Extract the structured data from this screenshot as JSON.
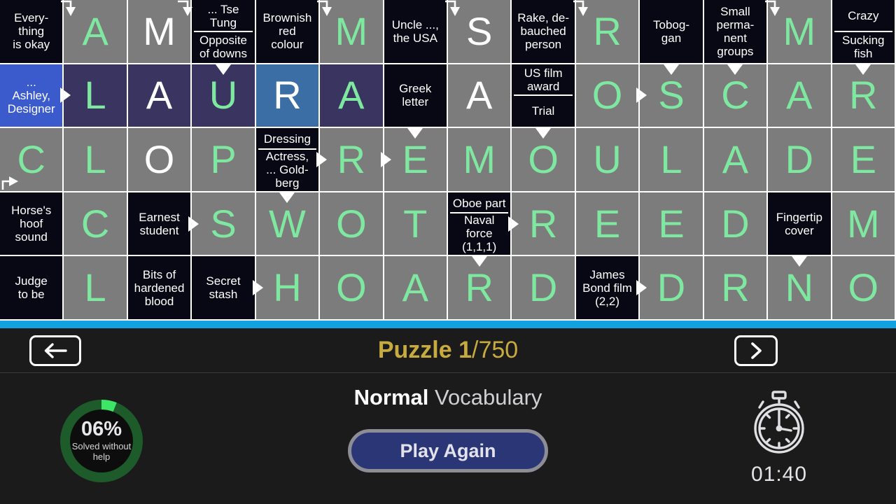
{
  "grid": {
    "cols": 14,
    "rows": 5,
    "colors": {
      "letter_cell": "#7c7c7c",
      "clue_cell": "#080814",
      "selected_cell": "#3a6ea5",
      "active_row": "#3a3460",
      "active_clue": "#3b5bcc",
      "letter_green": "#7fe8a0",
      "letter_white": "#ffffff",
      "grid_line": "#ffffff"
    },
    "cells": [
      [
        {
          "t": "clue",
          "lines": [
            "Every-",
            "thing",
            "is okay"
          ]
        },
        {
          "t": "letter",
          "ch": "A",
          "c": "green",
          "arrow": "down-from-left"
        },
        {
          "t": "letter",
          "ch": "M",
          "c": "white",
          "arrow": "down-from-left-right"
        },
        {
          "t": "clue2",
          "top": [
            "... Tse",
            "Tung"
          ],
          "bottom": [
            "Opposite",
            "of downs"
          ]
        },
        {
          "t": "clue",
          "lines": [
            "Brownish",
            "red",
            "colour"
          ]
        },
        {
          "t": "letter",
          "ch": "M",
          "c": "green",
          "arrow": "down-from-left"
        },
        {
          "t": "clue",
          "lines": [
            "Uncle ...,",
            "the USA"
          ]
        },
        {
          "t": "letter",
          "ch": "S",
          "c": "white",
          "arrow": "down-from-left"
        },
        {
          "t": "clue",
          "lines": [
            "Rake, de-",
            "bauched",
            "person"
          ]
        },
        {
          "t": "letter",
          "ch": "R",
          "c": "green",
          "arrow": "down-from-left"
        },
        {
          "t": "clue",
          "lines": [
            "Tobog-",
            "gan"
          ]
        },
        {
          "t": "clue",
          "lines": [
            "Small",
            "perma-",
            "nent",
            "groups"
          ]
        },
        {
          "t": "letter",
          "ch": "M",
          "c": "green",
          "arrow": "down-from-left"
        },
        {
          "t": "clue2",
          "top": [
            "Crazy"
          ],
          "bottom": [
            "Sucking",
            "fish"
          ]
        }
      ],
      [
        {
          "t": "clue",
          "lines": [
            "...",
            "Ashley,",
            "Designer"
          ],
          "active": true,
          "arrow": "right"
        },
        {
          "t": "letter",
          "ch": "L",
          "c": "green",
          "row_active": true
        },
        {
          "t": "letter",
          "ch": "A",
          "c": "white",
          "row_active": true
        },
        {
          "t": "letter",
          "ch": "U",
          "c": "green",
          "row_active": true,
          "arrow": "down"
        },
        {
          "t": "letter",
          "ch": "R",
          "c": "white",
          "selected": true
        },
        {
          "t": "letter",
          "ch": "A",
          "c": "green",
          "row_active": true
        },
        {
          "t": "clue",
          "lines": [
            "Greek",
            "letter"
          ]
        },
        {
          "t": "letter",
          "ch": "A",
          "c": "white"
        },
        {
          "t": "clue2",
          "top": [
            "US film",
            "award"
          ],
          "bottom": [
            "Trial"
          ]
        },
        {
          "t": "letter",
          "ch": "O",
          "c": "green",
          "arrow": "right"
        },
        {
          "t": "letter",
          "ch": "S",
          "c": "green",
          "arrow": "down"
        },
        {
          "t": "letter",
          "ch": "C",
          "c": "green",
          "arrow": "down"
        },
        {
          "t": "letter",
          "ch": "A",
          "c": "green"
        },
        {
          "t": "letter",
          "ch": "R",
          "c": "green",
          "arrow": "down"
        }
      ],
      [
        {
          "t": "letter",
          "ch": "C",
          "c": "green",
          "arrow": "right-from-bottom"
        },
        {
          "t": "letter",
          "ch": "L",
          "c": "green"
        },
        {
          "t": "letter",
          "ch": "O",
          "c": "white"
        },
        {
          "t": "letter",
          "ch": "P",
          "c": "green"
        },
        {
          "t": "clue2",
          "top": [
            "Dressing"
          ],
          "bottom": [
            "Actress,",
            "... Gold-",
            "berg"
          ],
          "arrow": "right"
        },
        {
          "t": "letter",
          "ch": "R",
          "c": "green",
          "arrow": "right"
        },
        {
          "t": "letter",
          "ch": "E",
          "c": "green",
          "arrow": "down"
        },
        {
          "t": "letter",
          "ch": "M",
          "c": "green"
        },
        {
          "t": "letter",
          "ch": "O",
          "c": "green",
          "arrow": "down"
        },
        {
          "t": "letter",
          "ch": "U",
          "c": "green"
        },
        {
          "t": "letter",
          "ch": "L",
          "c": "green"
        },
        {
          "t": "letter",
          "ch": "A",
          "c": "green"
        },
        {
          "t": "letter",
          "ch": "D",
          "c": "green"
        },
        {
          "t": "letter",
          "ch": "E",
          "c": "green"
        }
      ],
      [
        {
          "t": "clue",
          "lines": [
            "Horse's",
            "hoof",
            "sound"
          ]
        },
        {
          "t": "letter",
          "ch": "C",
          "c": "green"
        },
        {
          "t": "clue",
          "lines": [
            "Earnest",
            "student"
          ],
          "arrow": "right"
        },
        {
          "t": "letter",
          "ch": "S",
          "c": "green"
        },
        {
          "t": "letter",
          "ch": "W",
          "c": "green",
          "arrow": "down"
        },
        {
          "t": "letter",
          "ch": "O",
          "c": "green"
        },
        {
          "t": "letter",
          "ch": "T",
          "c": "green"
        },
        {
          "t": "clue2",
          "top": [
            "Oboe part"
          ],
          "bottom": [
            "Naval",
            "force",
            "(1,1,1)"
          ],
          "arrow": "right"
        },
        {
          "t": "letter",
          "ch": "R",
          "c": "green"
        },
        {
          "t": "letter",
          "ch": "E",
          "c": "green"
        },
        {
          "t": "letter",
          "ch": "E",
          "c": "green"
        },
        {
          "t": "letter",
          "ch": "D",
          "c": "green"
        },
        {
          "t": "clue",
          "lines": [
            "Fingertip",
            "cover"
          ]
        },
        {
          "t": "letter",
          "ch": "M",
          "c": "green"
        }
      ],
      [
        {
          "t": "clue",
          "lines": [
            "Judge",
            "to be"
          ]
        },
        {
          "t": "letter",
          "ch": "L",
          "c": "green"
        },
        {
          "t": "clue",
          "lines": [
            "Bits of",
            "hardened",
            "blood"
          ]
        },
        {
          "t": "clue",
          "lines": [
            "Secret",
            "stash"
          ],
          "arrow": "right"
        },
        {
          "t": "letter",
          "ch": "H",
          "c": "green"
        },
        {
          "t": "letter",
          "ch": "O",
          "c": "green"
        },
        {
          "t": "letter",
          "ch": "A",
          "c": "green"
        },
        {
          "t": "letter",
          "ch": "R",
          "c": "green",
          "arrow": "down"
        },
        {
          "t": "letter",
          "ch": "D",
          "c": "green"
        },
        {
          "t": "clue",
          "lines": [
            "James",
            "Bond film",
            "(2,2)"
          ],
          "arrow": "right"
        },
        {
          "t": "letter",
          "ch": "D",
          "c": "green"
        },
        {
          "t": "letter",
          "ch": "R",
          "c": "green"
        },
        {
          "t": "letter",
          "ch": "N",
          "c": "green",
          "arrow": "down"
        },
        {
          "t": "letter",
          "ch": "O",
          "c": "green"
        }
      ]
    ]
  },
  "nav": {
    "prev_icon": "arrow-left-icon",
    "next_icon": "arrow-right-icon",
    "puzzle_label": "Puzzle",
    "puzzle_number": "1",
    "puzzle_total": "/750",
    "title_color": "#c8ab3f"
  },
  "footer": {
    "vocab_level": "Normal",
    "vocab_word": " Vocabulary",
    "play_again_label": "Play Again",
    "progress": {
      "percent_text": "06%",
      "percent_value": 6,
      "label": "Solved without help",
      "ring_bg": "#1d5c2a",
      "ring_fg": "#3ee667"
    },
    "timer": {
      "icon": "stopwatch-icon",
      "time": "01:40"
    }
  }
}
